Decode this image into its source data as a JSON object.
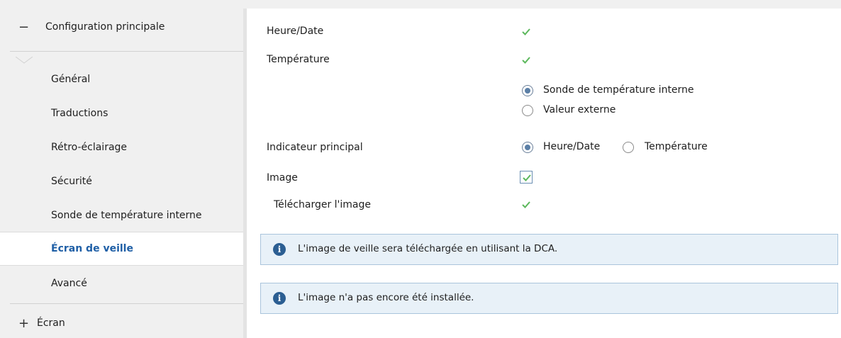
{
  "sidebar": {
    "main_group": {
      "sign": "−",
      "label": "Configuration principale"
    },
    "items": [
      {
        "label": "Général"
      },
      {
        "label": "Traductions"
      },
      {
        "label": "Rétro-éclairage"
      },
      {
        "label": "Sécurité"
      },
      {
        "label": "Sonde de température interne"
      },
      {
        "label": "Écran de veille"
      },
      {
        "label": "Avancé"
      }
    ],
    "active_item": "Écran de veille",
    "screen_group": {
      "sign": "+",
      "label": "Écran"
    }
  },
  "form": {
    "heure_date": {
      "label": "Heure/Date",
      "checked": true
    },
    "temperature": {
      "label": "Température",
      "checked": true,
      "options": [
        {
          "label": "Sonde de température interne",
          "selected": true
        },
        {
          "label": "Valeur externe",
          "selected": false
        }
      ]
    },
    "indicateur": {
      "label": "Indicateur principal",
      "options": [
        {
          "label": "Heure/Date",
          "selected": true
        },
        {
          "label": "Température",
          "selected": false
        }
      ]
    },
    "image": {
      "label": "Image",
      "checked": true
    },
    "telecharger": {
      "label": "Télécharger l'image",
      "checked": true
    }
  },
  "info": {
    "dca": "L'image de veille sera téléchargée en utilisant la DCA.",
    "not_installed": "L'image n'a pas encore été installée."
  },
  "colors": {
    "accent": "#1f5fa6",
    "check": "#5cb85c",
    "info_bg": "#e8f1f8",
    "info_border": "#aac4dc"
  }
}
